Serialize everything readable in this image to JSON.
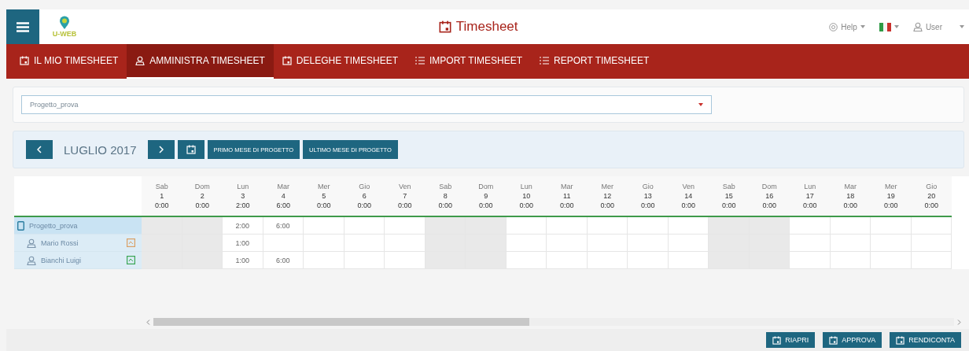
{
  "header": {
    "logo_text": "U-WEB",
    "title": "Timesheet",
    "help": "Help",
    "user": "User"
  },
  "nav": [
    {
      "label": "IL MIO TIMESHEET",
      "kind": "calendar",
      "selected": false
    },
    {
      "label": "AMMINISTRA TIMESHEET",
      "kind": "user",
      "selected": true
    },
    {
      "label": "DELEGHE TIMESHEET",
      "kind": "calendar",
      "selected": false
    },
    {
      "label": "IMPORT TIMESHEET",
      "kind": "list",
      "selected": false
    },
    {
      "label": "REPORT TIMESHEET",
      "kind": "list",
      "selected": false
    }
  ],
  "project_select": {
    "value": "Progetto_prova"
  },
  "toolbar": {
    "month": "LUGLIO 2017",
    "buttons": [
      "PRIMO MESE DI PROGETTO",
      "ULTIMO MESE DI PROGETTO"
    ]
  },
  "days": [
    {
      "weekday": "Sab",
      "day": "1",
      "total": "0:00"
    },
    {
      "weekday": "Dom",
      "day": "2",
      "total": "0:00"
    },
    {
      "weekday": "Lun",
      "day": "3",
      "total": "2:00"
    },
    {
      "weekday": "Mar",
      "day": "4",
      "total": "6:00"
    },
    {
      "weekday": "Mer",
      "day": "5",
      "total": "0:00"
    },
    {
      "weekday": "Gio",
      "day": "6",
      "total": "0:00"
    },
    {
      "weekday": "Ven",
      "day": "7",
      "total": "0:00"
    },
    {
      "weekday": "Sab",
      "day": "8",
      "total": "0:00"
    },
    {
      "weekday": "Dom",
      "day": "9",
      "total": "0:00"
    },
    {
      "weekday": "Lun",
      "day": "10",
      "total": "0:00"
    },
    {
      "weekday": "Mar",
      "day": "11",
      "total": "0:00"
    },
    {
      "weekday": "Mer",
      "day": "12",
      "total": "0:00"
    },
    {
      "weekday": "Gio",
      "day": "13",
      "total": "0:00"
    },
    {
      "weekday": "Ven",
      "day": "14",
      "total": "0:00"
    },
    {
      "weekday": "Sab",
      "day": "15",
      "total": "0:00"
    },
    {
      "weekday": "Dom",
      "day": "16",
      "total": "0:00"
    },
    {
      "weekday": "Lun",
      "day": "17",
      "total": "0:00"
    },
    {
      "weekday": "Mar",
      "day": "18",
      "total": "0:00"
    },
    {
      "weekday": "Mer",
      "day": "19",
      "total": "0:00"
    },
    {
      "weekday": "Gio",
      "day": "20",
      "total": "0:00"
    }
  ],
  "rows": [
    {
      "kind": "project",
      "name": "Progetto_prova",
      "cells": [
        {
          "kind": "weekend"
        },
        {
          "kind": "weekend"
        },
        {
          "kind": "weekday",
          "hours": "2:00"
        },
        {
          "kind": "weekday",
          "hours": "6:00"
        },
        {
          "kind": "weekday"
        },
        {
          "kind": "weekday"
        },
        {
          "kind": "weekday"
        },
        {
          "kind": "weekend"
        },
        {
          "kind": "weekend"
        },
        {
          "kind": "weekday"
        },
        {
          "kind": "weekday"
        },
        {
          "kind": "weekday"
        },
        {
          "kind": "weekday"
        },
        {
          "kind": "weekday"
        },
        {
          "kind": "weekend"
        },
        {
          "kind": "weekend"
        },
        {
          "kind": "weekday"
        },
        {
          "kind": "weekday"
        },
        {
          "kind": "weekday"
        },
        {
          "kind": "weekday"
        }
      ]
    },
    {
      "kind": "person",
      "name": "Mario Rossi",
      "color": "#d9a066",
      "cells": [
        {
          "kind": "weekend"
        },
        {
          "kind": "weekend"
        },
        {
          "kind": "weekday",
          "hours": "1:00"
        },
        {
          "kind": "weekday"
        },
        {
          "kind": "weekday"
        },
        {
          "kind": "weekday"
        },
        {
          "kind": "weekday"
        },
        {
          "kind": "weekend"
        },
        {
          "kind": "weekend"
        },
        {
          "kind": "weekday"
        },
        {
          "kind": "weekday"
        },
        {
          "kind": "weekday"
        },
        {
          "kind": "weekday"
        },
        {
          "kind": "weekday"
        },
        {
          "kind": "weekend"
        },
        {
          "kind": "weekend"
        },
        {
          "kind": "weekday"
        },
        {
          "kind": "weekday"
        },
        {
          "kind": "weekday"
        },
        {
          "kind": "weekday"
        }
      ]
    },
    {
      "kind": "person",
      "name": "Bianchi Luigi",
      "color": "#3aa655",
      "cells": [
        {
          "kind": "weekend"
        },
        {
          "kind": "weekend"
        },
        {
          "kind": "weekday",
          "hours": "1:00"
        },
        {
          "kind": "weekday",
          "hours": "6:00"
        },
        {
          "kind": "weekday"
        },
        {
          "kind": "weekday"
        },
        {
          "kind": "weekday"
        },
        {
          "kind": "weekend"
        },
        {
          "kind": "weekend"
        },
        {
          "kind": "weekday"
        },
        {
          "kind": "weekday"
        },
        {
          "kind": "weekday"
        },
        {
          "kind": "weekday"
        },
        {
          "kind": "weekday"
        },
        {
          "kind": "weekend"
        },
        {
          "kind": "weekend"
        },
        {
          "kind": "weekday"
        },
        {
          "kind": "weekday"
        },
        {
          "kind": "weekday"
        },
        {
          "kind": "weekday"
        }
      ]
    }
  ],
  "footer_buttons": [
    "RIAPRI",
    "APPROVA",
    "RENDICONTA"
  ]
}
